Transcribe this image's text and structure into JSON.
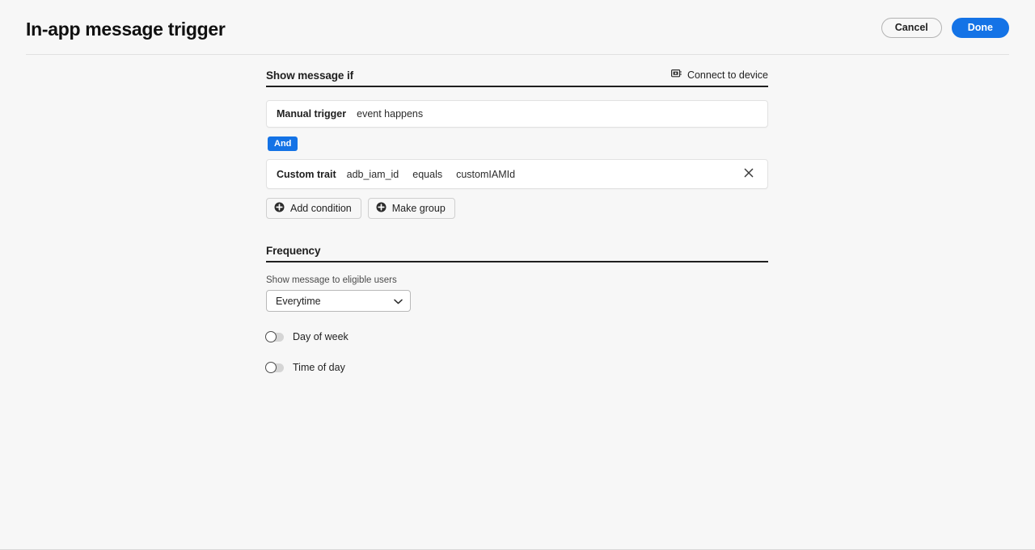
{
  "header": {
    "title": "In-app message trigger",
    "cancel_label": "Cancel",
    "done_label": "Done"
  },
  "trigger_section": {
    "title": "Show message if",
    "connect_device_label": "Connect to device",
    "connect_device_icon": "device-monitor-icon",
    "rows": [
      {
        "label": "Manual trigger",
        "tokens": [
          "event happens"
        ],
        "removable": false
      },
      {
        "label": "Custom trait",
        "tokens": [
          "adb_iam_id",
          "equals",
          "customIAMId"
        ],
        "removable": true,
        "remove_icon": "close-icon"
      }
    ],
    "operator_badge": "And",
    "add_condition_label": "Add condition",
    "make_group_label": "Make group",
    "add_icon": "plus-circle-icon"
  },
  "frequency_section": {
    "title": "Frequency",
    "select_label": "Show message to eligible users",
    "select_value": "Everytime",
    "select_icon": "chevron-down-icon",
    "toggles": [
      {
        "label": "Day of week",
        "on": false
      },
      {
        "label": "Time of day",
        "on": false
      }
    ]
  },
  "colors": {
    "accent_blue": "#1473e6",
    "page_background": "#f7f7f7",
    "rule_black": "#1f1f1f"
  }
}
